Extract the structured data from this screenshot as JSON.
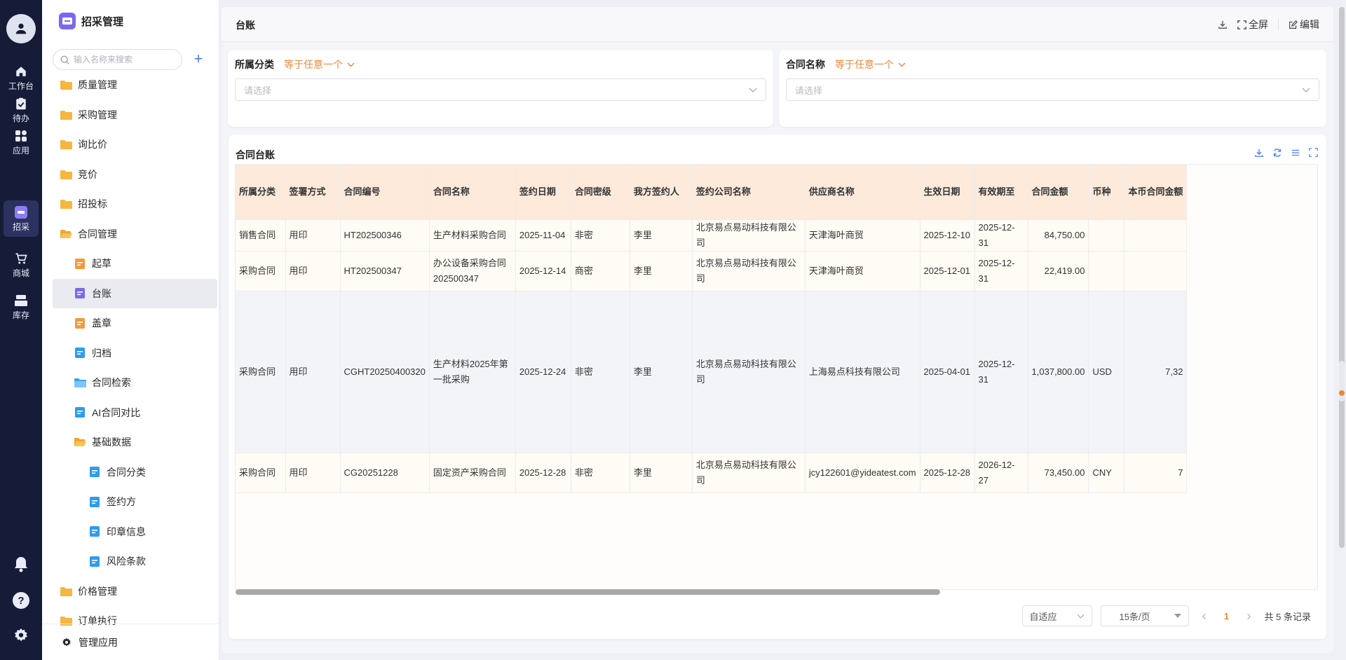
{
  "rail": {
    "items": [
      {
        "label": "工作台",
        "icon": "home-icon"
      },
      {
        "label": "待办",
        "icon": "clipboard-check-icon"
      },
      {
        "label": "应用",
        "icon": "apps-grid-icon"
      },
      {
        "label": "招采",
        "icon": "procurement-icon",
        "active": true
      },
      {
        "label": "商城",
        "icon": "cart-icon"
      },
      {
        "label": "库存",
        "icon": "inventory-icon"
      }
    ]
  },
  "nav": {
    "title": "招采管理",
    "search_placeholder": "输入名称来搜索",
    "items": [
      {
        "label": "质量管理"
      },
      {
        "label": "采购管理"
      },
      {
        "label": "询比价"
      },
      {
        "label": "竞价"
      },
      {
        "label": "招投标"
      },
      {
        "label": "合同管理"
      },
      {
        "label": "起草"
      },
      {
        "label": "台账"
      },
      {
        "label": "盖章"
      },
      {
        "label": "归档"
      },
      {
        "label": "合同检索"
      },
      {
        "label": "AI合同对比"
      },
      {
        "label": "基础数据"
      },
      {
        "label": "合同分类"
      },
      {
        "label": "签约方"
      },
      {
        "label": "印章信息"
      },
      {
        "label": "风险条款"
      },
      {
        "label": "价格管理"
      },
      {
        "label": "订单执行"
      }
    ],
    "footer_label": "管理应用"
  },
  "topbar": {
    "title": "台账",
    "fullscreen_label": "全屏",
    "edit_label": "编辑"
  },
  "filters": [
    {
      "label": "所属分类",
      "operator": "等于任意一个",
      "placeholder": "请选择"
    },
    {
      "label": "合同名称",
      "operator": "等于任意一个",
      "placeholder": "请选择"
    }
  ],
  "table": {
    "title": "合同台账",
    "columns": [
      "所属分类",
      "签署方式",
      "合同编号",
      "合同名称",
      "签约日期",
      "合同密级",
      "我方签约人",
      "签约公司名称",
      "供应商名称",
      "生效日期",
      "有效期至",
      "合同金额",
      "币种",
      "本币合同金额"
    ],
    "rows": [
      [
        "销售合同",
        "用印",
        "HT202500346",
        "生产材料采购合同",
        "2025-11-04",
        "非密",
        "李里",
        "北京易点易动科技有限公司",
        "天津海叶商贸",
        "2025-12-10",
        "2025-12-31",
        "84,750.00",
        "",
        ""
      ],
      [
        "采购合同",
        "用印",
        "HT202500347",
        "办公设备采购合同202500347",
        "2025-12-14",
        "商密",
        "李里",
        "北京易点易动科技有限公司",
        "天津海叶商贸",
        "2025-12-01",
        "2025-12-31",
        "22,419.00",
        "",
        ""
      ],
      [
        "采购合同",
        "用印",
        "CGHT20250400320",
        "生产材料2025年第一批采购",
        "2025-12-24",
        "非密",
        "李里",
        "北京易点易动科技有限公司",
        "上海易点科技有限公司",
        "2025-04-01",
        "2025-12-31",
        "1,037,800.00",
        "USD",
        "7,32"
      ],
      [
        "采购合同",
        "用印",
        "CG20251228",
        "固定资产采购合同",
        "2025-12-28",
        "非密",
        "李里",
        "北京易点易动科技有限公司",
        "jcy122601@yideatest.com",
        "2025-12-28",
        "2026-12-27",
        "73,450.00",
        "CNY",
        "7"
      ]
    ]
  },
  "pager": {
    "size_mode": "自适应",
    "page_size": "15条/页",
    "current_page": "1",
    "total_label": "共 5 条记录"
  }
}
